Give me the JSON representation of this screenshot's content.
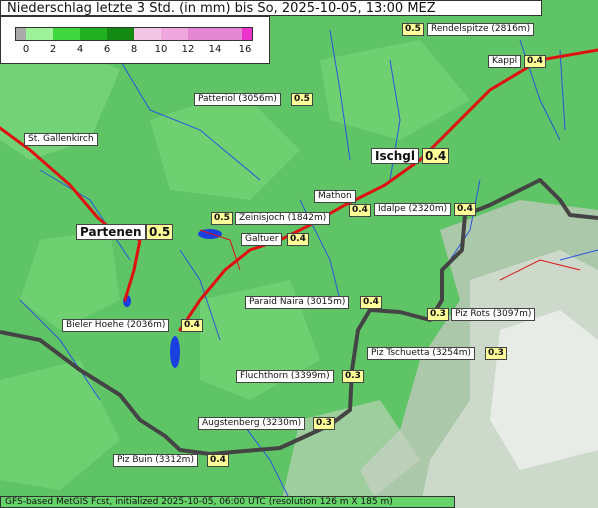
{
  "title": "Niederschlag letzte 3 Std. (in mm) bis So, 2025-10-05, 13:00 MEZ",
  "legend": {
    "ticks": [
      "0",
      "2",
      "4",
      "6",
      "8",
      "10",
      "12",
      "14",
      "16"
    ],
    "colors": [
      "#aaaaaa",
      "#9ef29a",
      "#3fd63f",
      "#22b022",
      "#138a13",
      "#f4c6e6",
      "#eea6dc",
      "#e487d2",
      "#ee33cc"
    ]
  },
  "places": {
    "rendelspitze": {
      "name": "Rendelspitze (2816m)",
      "value": "0.5"
    },
    "kappl": {
      "name": "Kappl",
      "value": "0.4"
    },
    "patteriol": {
      "name": "Patteriol (3056m)",
      "value": "0.5"
    },
    "st_gallenkirch": {
      "name": "St. Gallenkirch"
    },
    "ischgl": {
      "name": "Ischgl",
      "value": "0.4"
    },
    "mathon": {
      "name": "Mathon",
      "value": "0.4"
    },
    "idalpe": {
      "name": "Idalpe (2320m)",
      "value": "0.4"
    },
    "zeinisjoch": {
      "name": "Zeinisjoch (1842m)",
      "value": "0.5"
    },
    "partenen": {
      "name": "Partenen",
      "value": "0.5"
    },
    "galtuer": {
      "name": "Galtuer",
      "value": "0.4"
    },
    "paraid_naira": {
      "name": "Paraid Naira (3015m)",
      "value": "0.4"
    },
    "piz_rots": {
      "name": "Piz Rots (3097m)",
      "value": "0.3"
    },
    "bieler_hoehe": {
      "name": "Bieler Hoehe (2036m)",
      "value": "0.4"
    },
    "piz_tschuetta": {
      "name": "Piz Tschuetta (3254m)",
      "value": "0.3"
    },
    "fluchthorn": {
      "name": "Fluchthorn (3399m)",
      "value": "0.3"
    },
    "augstenberg": {
      "name": "Augstenberg (3230m)",
      "value": "0.3"
    },
    "piz_buin": {
      "name": "Piz Buin (3312m)",
      "value": "0.4"
    }
  },
  "footer": "GFS-based MetGIS Fcst, initialized 2025-10-05, 06:00 UTC  (resolution 126 m X 185 m)"
}
